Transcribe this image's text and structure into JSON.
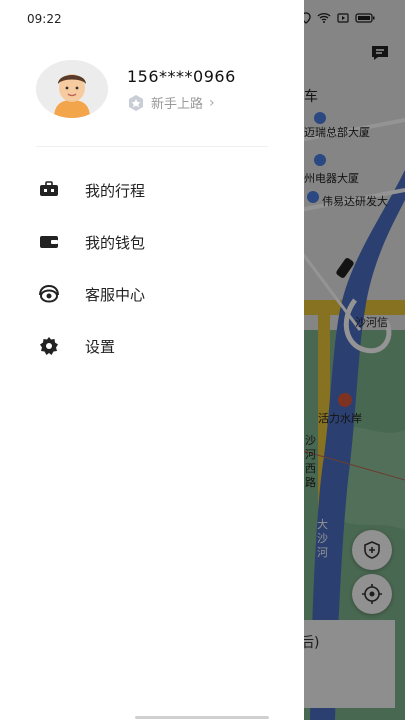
{
  "status_bar": {
    "time": "09:22"
  },
  "profile": {
    "phone": "156****0966",
    "level": "新手上路"
  },
  "menu": [
    {
      "label": "我的行程",
      "icon": "briefcase-icon"
    },
    {
      "label": "我的钱包",
      "icon": "wallet-icon"
    },
    {
      "label": "客服中心",
      "icon": "headset-icon"
    },
    {
      "label": "设置",
      "icon": "gear-icon"
    }
  ],
  "map": {
    "tab_partial": "车",
    "labels": [
      "迈瑞总部大厦",
      "州电器大厦",
      "伟易达研发大",
      "沙河信",
      "活力水岸",
      "沙",
      "河",
      "西",
      "路",
      "大",
      "沙",
      "河"
    ],
    "bottom_card_partial": "后)"
  },
  "colors": {
    "drawer_bg": "#ffffff",
    "river": "#4a6fc1",
    "park": "#7fb38c",
    "road_yellow": "#e9c53a"
  }
}
